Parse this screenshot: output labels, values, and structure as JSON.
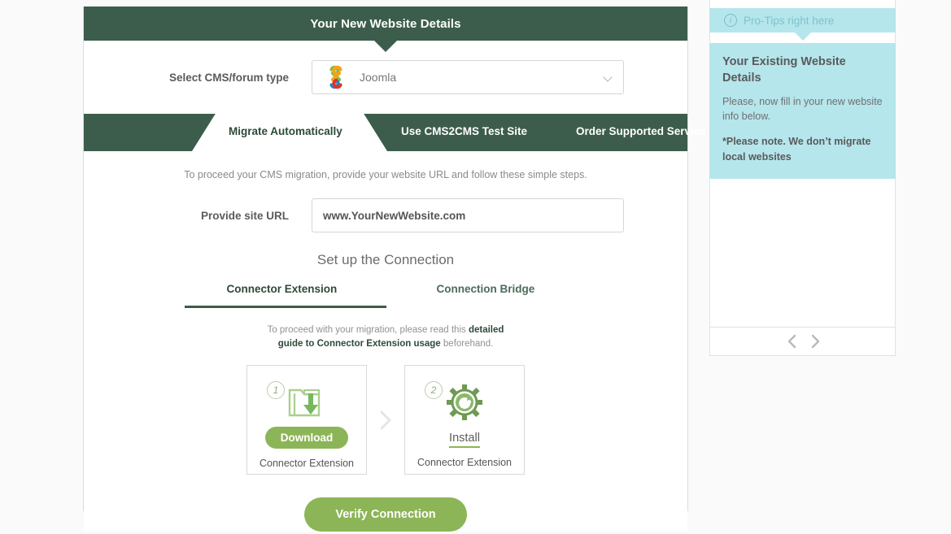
{
  "main": {
    "header_title": "Your New Website Details",
    "cms_select": {
      "label": "Select CMS/forum type",
      "value": "Joomla",
      "caret_icon": "chevron-down-icon"
    },
    "tabs": [
      {
        "label": "Migrate Automatically",
        "active": true
      },
      {
        "label": "Use CMS2CMS Test Site",
        "active": false
      },
      {
        "label": "Order Supported Service",
        "active": false
      }
    ],
    "intro_text": "To proceed your CMS migration, provide your website URL and follow these simple steps.",
    "url_field": {
      "label": "Provide site URL",
      "value": "www.YourNewWebsite.com",
      "placeholder": "www.YourNewWebsite.com"
    },
    "setup_title": "Set up the Connection",
    "subtabs": [
      {
        "label": "Connector Extension",
        "active": true
      },
      {
        "label": "Connection Bridge",
        "active": false
      }
    ],
    "guide": {
      "prefix": "To proceed with your migration, please read this ",
      "link": "detailed guide to Connector Extension usage",
      "suffix": " beforehand."
    },
    "steps": [
      {
        "number": "1",
        "icon": "folder-download-icon",
        "action_label": "Download",
        "caption": "Connector Extension"
      },
      {
        "number": "2",
        "icon": "gear-refresh-icon",
        "action_label": "Install",
        "caption": "Connector Extension"
      }
    ],
    "step_separator_icon": "chevron-right-icon",
    "verify_button": "Verify Connection"
  },
  "sidebar": {
    "tips_header": {
      "icon": "info-icon",
      "label": "Pro-Tips right here"
    },
    "tips_card": {
      "title": "Your Existing Website Details",
      "body": "Please, now fill in your new website info below.",
      "note": "*Please note. We don’t migrate local websites"
    },
    "nav": {
      "prev_icon": "chevron-left-icon",
      "next_icon": "chevron-right-icon"
    }
  },
  "colors": {
    "dark_green": "#3c5d4b",
    "accent_green": "#8cb557",
    "tips_cyan": "#b5e6ec"
  }
}
